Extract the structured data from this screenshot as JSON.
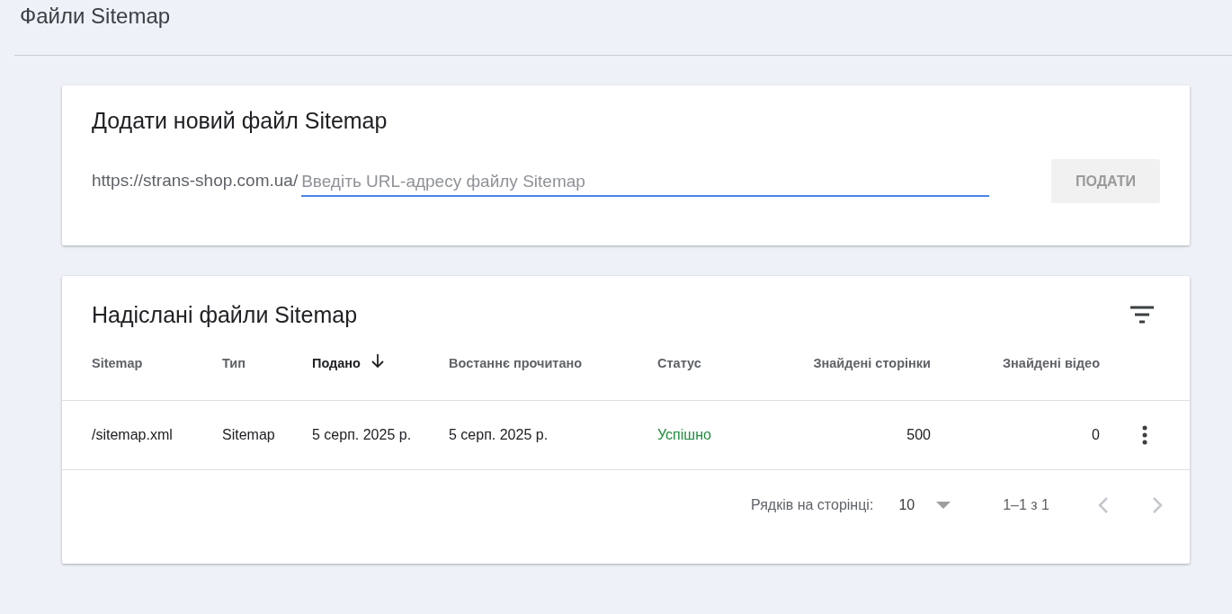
{
  "page_title": "Файли Sitemap",
  "add_card": {
    "title": "Додати новий файл Sitemap",
    "url_prefix": "https://strans-shop.com.ua/",
    "placeholder": "Введіть URL-адресу файлу Sitemap",
    "button": {
      "label": "ПОДАТИ",
      "disabled": true
    }
  },
  "submitted_card": {
    "title": "Надіслані файли Sitemap",
    "table": {
      "columns": [
        {
          "label": "Sitemap",
          "kind": "text",
          "sorted": false
        },
        {
          "label": "Тип",
          "kind": "text",
          "sorted": false
        },
        {
          "label": "Подано",
          "kind": "text",
          "sorted": true
        },
        {
          "label": "Востаннє прочитано",
          "kind": "text",
          "sorted": false
        },
        {
          "label": "Статус",
          "kind": "status",
          "sorted": false
        },
        {
          "label": "Знайдені сторінки",
          "kind": "number",
          "sorted": false
        },
        {
          "label": "Знайдені відео",
          "kind": "number",
          "sorted": false
        }
      ],
      "rows": [
        {
          "cells": [
            "/sitemap.xml",
            "Sitemap",
            "5 серп. 2025 р.",
            "5 серп. 2025 р.",
            "Успішно",
            "500",
            "0"
          ]
        }
      ]
    },
    "pagination": {
      "rows_label": "Рядків на сторінці:",
      "rows_per_page": "10",
      "range": "1–1 з 1",
      "prev_disabled": true,
      "next_disabled": true
    }
  }
}
